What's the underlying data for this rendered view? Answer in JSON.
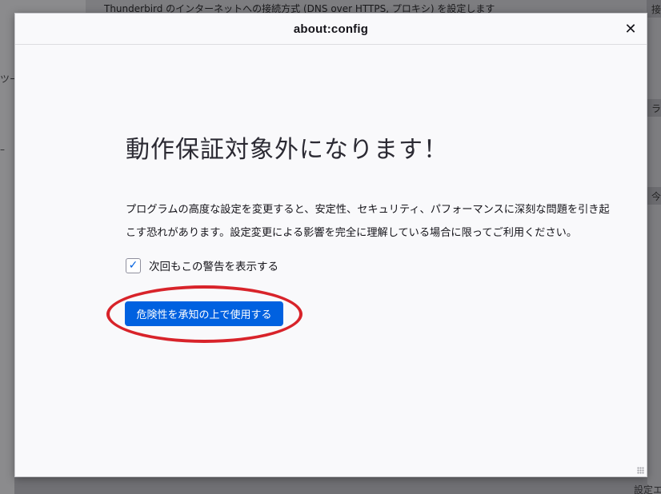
{
  "background": {
    "top_text": "Thunderbird のインターネットへの接続方式 (DNS over HTTPS, プロキシ) を設定します",
    "right_tabs": [
      "接",
      "ライ",
      "今"
    ],
    "left_fragments": [
      "ツー",
      "–"
    ],
    "bottom_right": "設定エ"
  },
  "dialog": {
    "title": "about:config",
    "close_glyph": "✕",
    "heading": "動作保証対象外になります！",
    "description": "プログラムの高度な設定を変更すると、安定性、セキュリティ、パフォーマンスに深刻な問題を引き起こす恐れがあります。設定変更による影響を完全に理解している場合に限ってご利用ください。",
    "checkbox": {
      "label": "次回もこの警告を表示する",
      "checked_glyph": "✓"
    },
    "accept_button": "危険性を承知の上で使用する"
  },
  "colors": {
    "accent": "#0061e0",
    "highlight": "#d8232a"
  }
}
